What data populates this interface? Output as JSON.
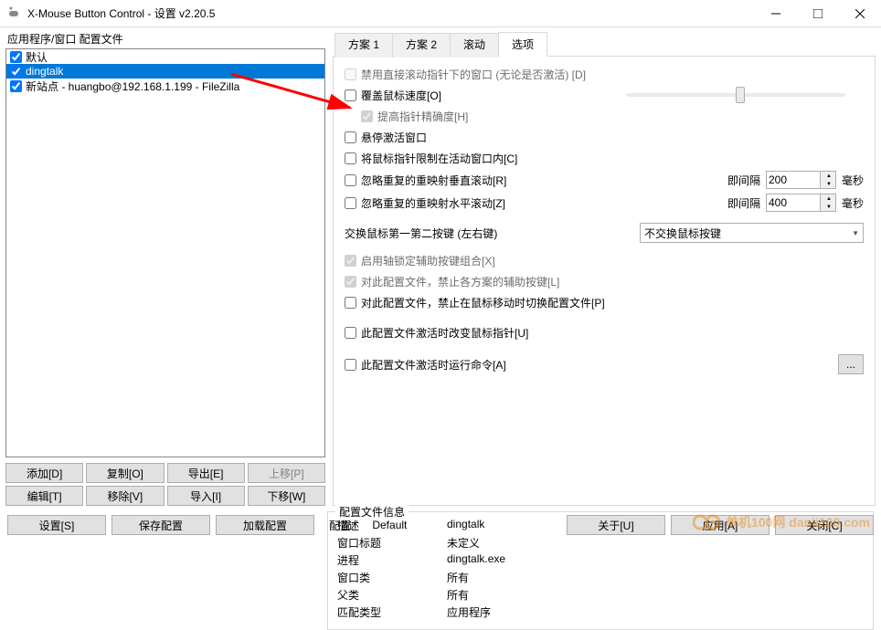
{
  "title": "X-Mouse Button Control - 设置 v2.20.5",
  "left": {
    "group_label": "应用程序/窗口 配置文件",
    "items": [
      {
        "label": "默认",
        "checked": true,
        "selected": false
      },
      {
        "label": "dingtalk",
        "checked": true,
        "selected": true
      },
      {
        "label": "新站点 - huangbo@192.168.1.199 - FileZilla",
        "checked": true,
        "selected": false
      }
    ],
    "buttons": {
      "add": "添加[D]",
      "copy": "复制[O]",
      "export": "导出[E]",
      "moveup": "上移[P]",
      "edit": "编辑[T]",
      "remove": "移除[V]",
      "import": "导入[I]",
      "movedown": "下移[W]"
    }
  },
  "tabs": {
    "t1": "方案 1",
    "t2": "方案 2",
    "t3": "滚动",
    "t4": "选项"
  },
  "options": {
    "disable_scroll": "禁用直接滚动指针下的窗口 (无论是否激活) [D]",
    "override_speed": "覆盖鼠标速度[O]",
    "enhance_precision": "提高指针精确度[H]",
    "deactivate_hover": "悬停激活窗口",
    "lock_cursor": "将鼠标指针限制在活动窗口内[C]",
    "ignore_vertical": "忽略重复的重映射垂直滚动[R]",
    "ignore_horizontal": "忽略重复的重映射水平滚动[Z]",
    "interval_label": "即间隔",
    "interval_v": "200",
    "interval_h": "400",
    "unit": "毫秒",
    "swap_label": "交换鼠标第一第二按键 (左右键)",
    "swap_value": "不交换鼠标按键",
    "enable_axis_lock": "启用轴锁定辅助按键组合[X]",
    "disable_accel": "对此配置文件，禁止各方案的辅助按键[L]",
    "disable_switch": "对此配置文件，禁止在鼠标移动时切换配置文件[P]",
    "change_cursor": "此配置文件激活时改变鼠标指针[U]",
    "run_command": "此配置文件激活时运行命令[A]",
    "browse": "..."
  },
  "info": {
    "legend": "配置文件信息",
    "desc_label": "描述",
    "desc_value": "dingtalk",
    "title_label": "窗口标题",
    "title_value": "未定义",
    "process_label": "进程",
    "process_value": "dingtalk.exe",
    "class_label": "窗口类",
    "class_value": "所有",
    "parent_label": "父类",
    "parent_value": "所有",
    "match_label": "匹配类型",
    "match_value": "应用程序"
  },
  "bottom": {
    "settings": "设置[S]",
    "save": "保存配置",
    "load": "加载配置",
    "config_label": "配置:",
    "config_value": "Default",
    "about": "关于[U]",
    "apply": "应用[A]",
    "close": "关闭[C]"
  },
  "watermark": "单机100网 danji100.com"
}
